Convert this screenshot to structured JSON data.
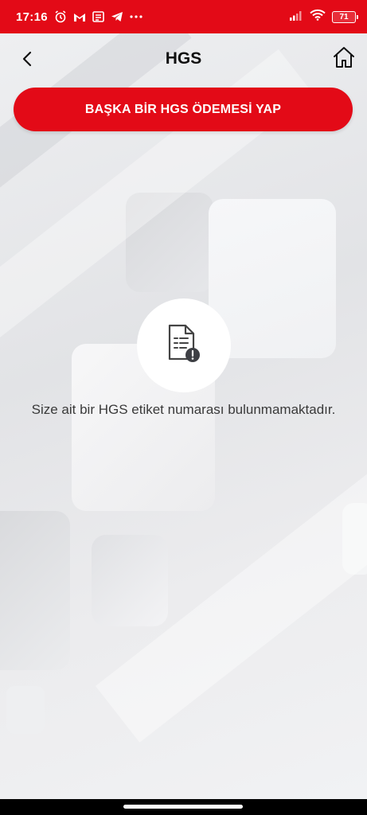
{
  "status_bar": {
    "time": "17:16",
    "battery": "71",
    "icons": [
      "alarm-icon",
      "gmail-icon",
      "news-icon",
      "telegram-icon",
      "more-dots-icon",
      "signal-icon",
      "wifi-icon",
      "battery-icon"
    ]
  },
  "header": {
    "title": "HGS",
    "back_icon": "chevron-left-icon",
    "home_icon": "home-icon"
  },
  "actions": {
    "new_payment_label": "BAŞKA BİR HGS ÖDEMESİ YAP"
  },
  "empty_state": {
    "icon": "document-alert-icon",
    "message": "Size ait bir HGS etiket numarası bulunmamaktadır."
  },
  "colors": {
    "brand_red": "#e30a17",
    "background": "#e9eaec",
    "text_dark": "#111111",
    "text_body": "#3a3a3a"
  }
}
